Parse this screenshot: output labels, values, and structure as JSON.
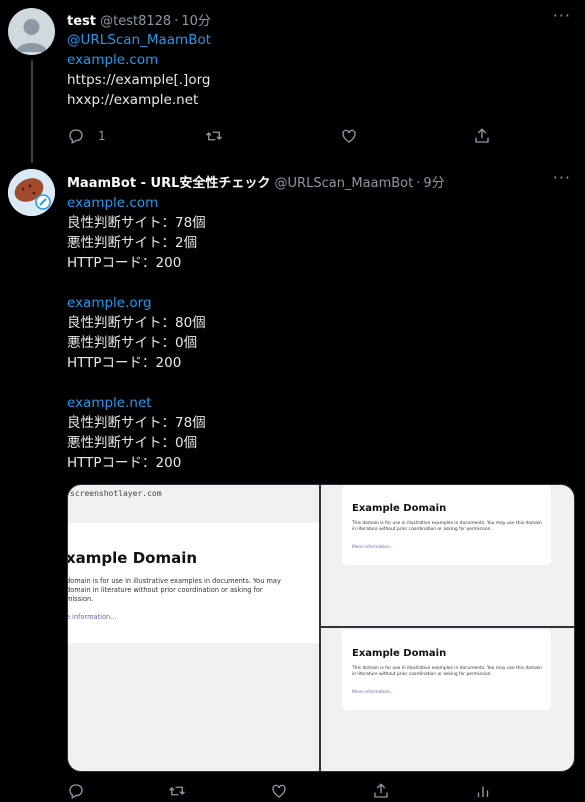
{
  "tweet1": {
    "name": "test",
    "handle": "@test8128",
    "time": "10分",
    "more": "···",
    "lines": [
      "@URLScan_MaamBot",
      "example.com",
      "https://example[.]org",
      "hxxp://example.net"
    ],
    "reply_count": "1"
  },
  "tweet2": {
    "name": "MaamBot - URL安全性チェック",
    "handle": "@URLScan_MaamBot",
    "time": "9分",
    "more": "···",
    "results": [
      {
        "domain": "example.com",
        "benign": "良性判断サイト：78個",
        "malicious": "悪性判断サイト：2個",
        "http": "HTTPコード：200"
      },
      {
        "domain": "example.org",
        "benign": "良性判断サイト：80個",
        "malicious": "悪性判断サイト：0個",
        "http": "HTTPコード：200"
      },
      {
        "domain": "example.net",
        "benign": "良性判断サイト：78個",
        "malicious": "悪性判断サイト：0個",
        "http": "HTTPコード：200"
      }
    ],
    "screenshots": {
      "watermark": "screenshotlayer.com",
      "title": "Example Domain",
      "paragraph": "This domain is for use in illustrative examples in documents. You may use this domain in literature without prior coordination or asking for permission.",
      "more_link": "More information...",
      "big_title": "xample Domain",
      "big_l1": "domain is for use in illustrative examples in documents. You may",
      "big_l2": "domain in literature without prior coordination or asking for",
      "big_l3": "mission.",
      "big_more": "e information..."
    }
  },
  "colors": {
    "link": "#1d9bf0",
    "muted": "#8b98a5",
    "background": "#000000"
  },
  "icons": [
    "reply-icon",
    "retweet-icon",
    "like-icon",
    "share-icon",
    "analytics-icon",
    "more-icon"
  ]
}
